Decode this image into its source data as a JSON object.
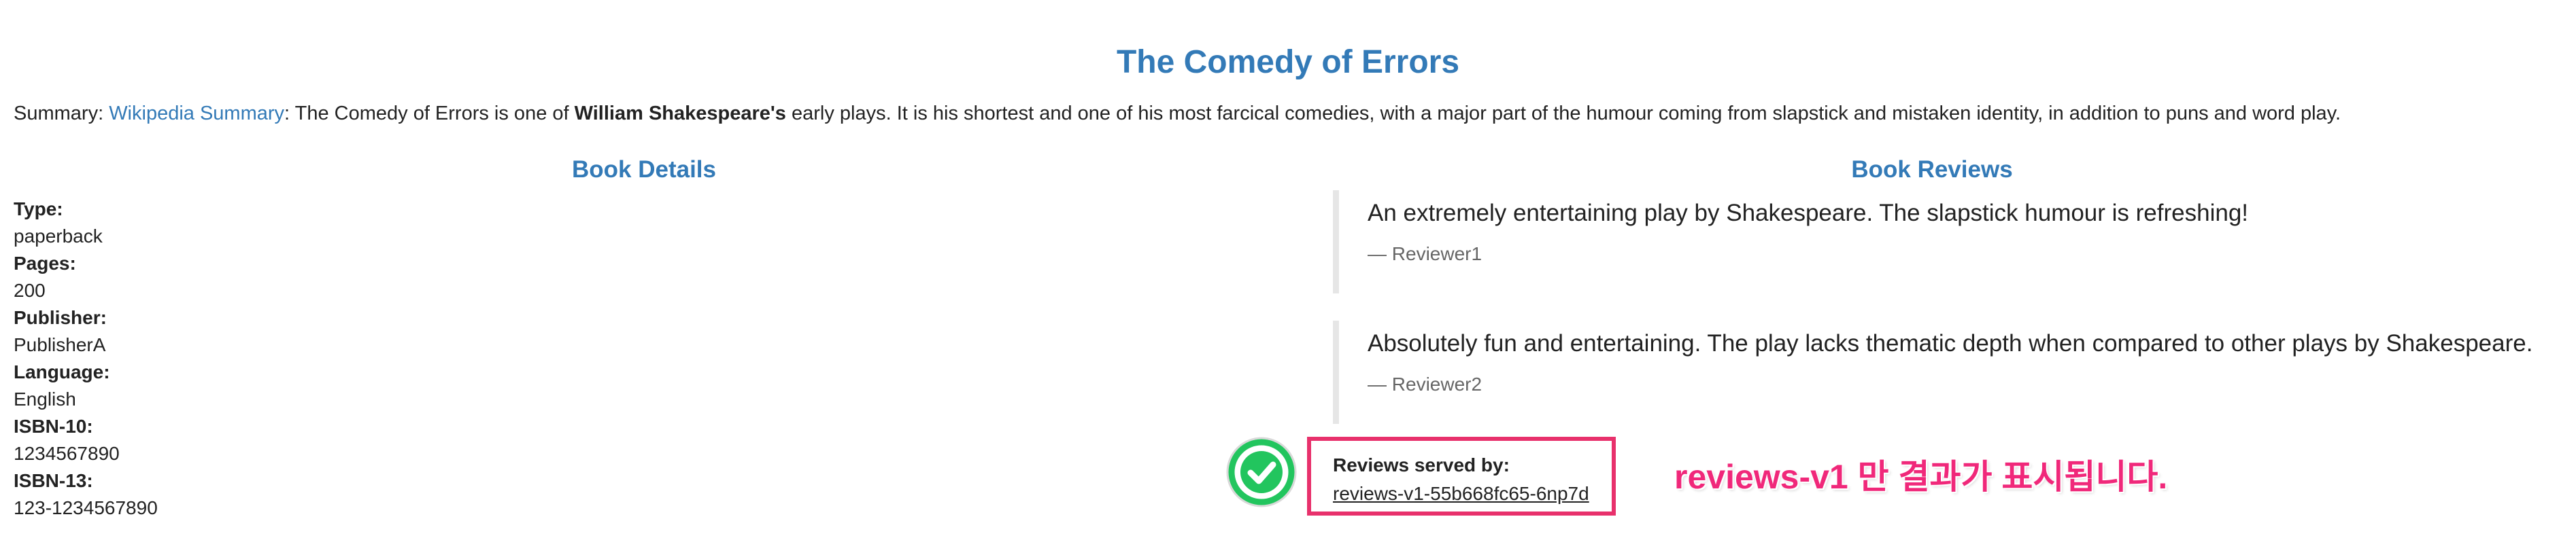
{
  "book": {
    "title": "The Comedy of Errors",
    "summary_prefix": "Summary: ",
    "summary_link": "Wikipedia Summary",
    "summary_mid": ": The Comedy of Errors is one of ",
    "summary_bold": "William Shakespeare's",
    "summary_rest": " early plays. It is his shortest and one of his most farcical comedies, with a major part of the humour coming from slapstick and mistaken identity, in addition to puns and word play."
  },
  "details": {
    "heading": "Book Details",
    "items": [
      {
        "label": "Type:",
        "value": "paperback"
      },
      {
        "label": "Pages:",
        "value": "200"
      },
      {
        "label": "Publisher:",
        "value": "PublisherA"
      },
      {
        "label": "Language:",
        "value": "English"
      },
      {
        "label": "ISBN-10:",
        "value": "1234567890"
      },
      {
        "label": "ISBN-13:",
        "value": "123-1234567890"
      }
    ]
  },
  "reviews": {
    "heading": "Book Reviews",
    "items": [
      {
        "text": "An extremely entertaining play by Shakespeare. The slapstick humour is refreshing!",
        "author": "— Reviewer1"
      },
      {
        "text": "Absolutely fun and entertaining. The play lacks thematic depth when compared to other plays by Shakespeare.",
        "author": "— Reviewer2"
      }
    ],
    "served_label": "Reviews served by:",
    "served_pod": "reviews-v1-55b668fc65-6np7d"
  },
  "annotation": {
    "text": "reviews-v1 만 결과가 표시됩니다.",
    "icon": "check-circle-icon"
  },
  "colors": {
    "link": "#337ab7",
    "highlight": "#e8316c",
    "annotation": "#f0287a",
    "check": "#22c55e"
  }
}
